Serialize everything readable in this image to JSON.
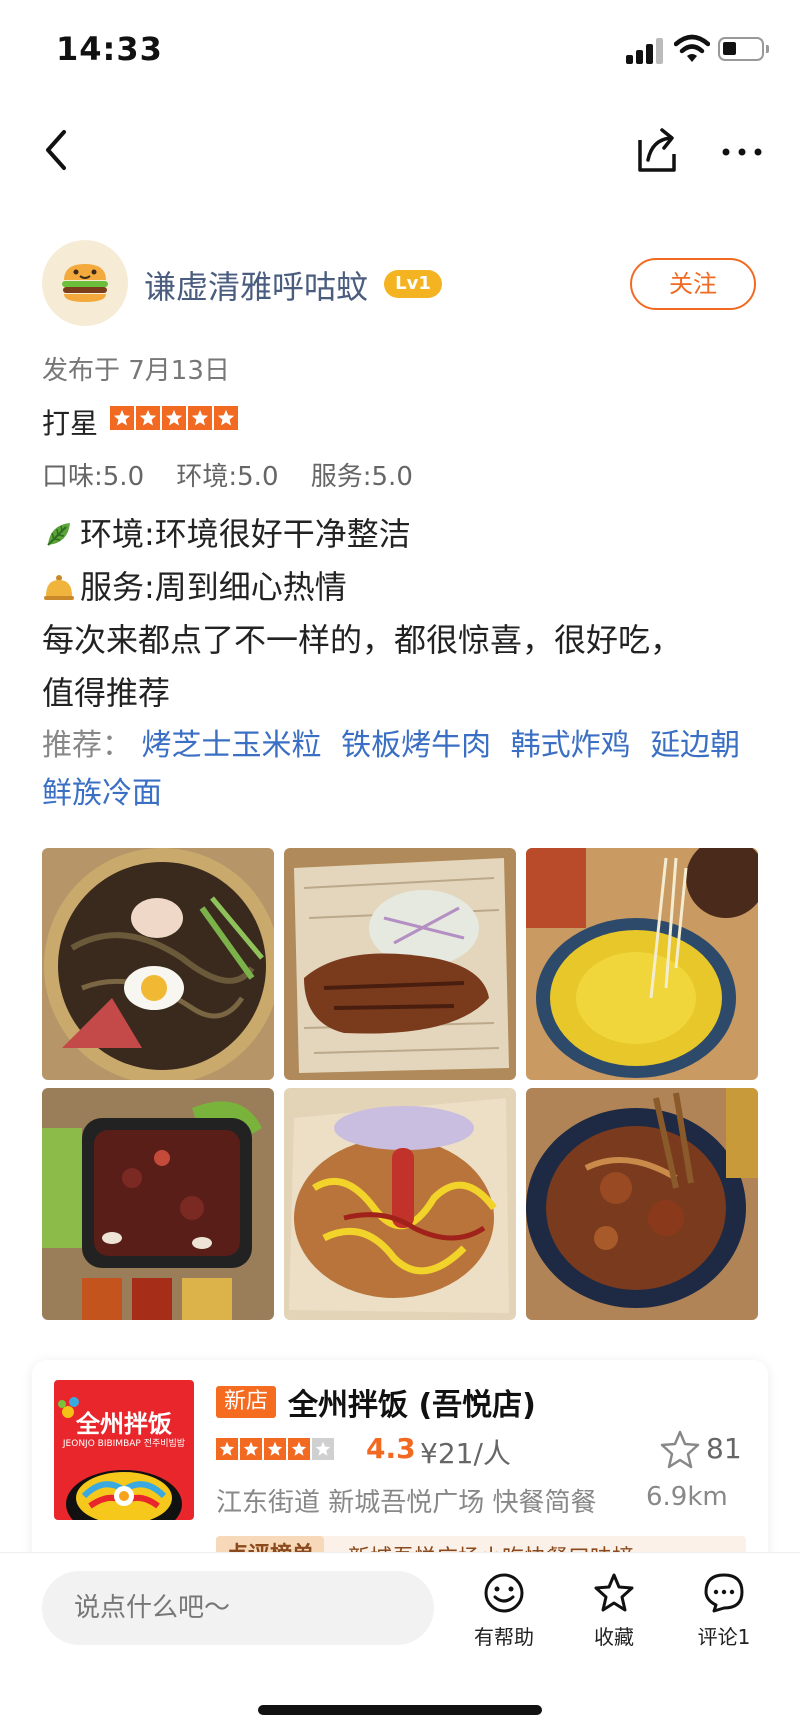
{
  "status_bar": {
    "time": "14:33"
  },
  "author": {
    "name": "谦虚清雅呼咕蚊",
    "level": "Lv1",
    "follow_label": "关注"
  },
  "post": {
    "date": "发布于 7月13日",
    "rating_label": "打星",
    "rating_stars": 5,
    "subscores": [
      "口味:5.0",
      "环境:5.0",
      "服务:5.0"
    ],
    "lines": [
      "环境:环境很好干净整洁",
      "服务:周到细心热情",
      "每次来都点了不一样的，都很惊喜，很好吃，",
      "值得推荐"
    ],
    "recommend_label": "推荐：",
    "recommend_dishes": [
      "烤芝士玉米粒",
      "铁板烤牛肉",
      "韩式炸鸡",
      "延边朝鲜族冷面"
    ]
  },
  "photos": [
    "冷面",
    "猪排",
    "芝士玉米",
    "烤牛肉",
    "炸鸡",
    "铁板鱿鱼"
  ],
  "shop": {
    "logo_text": "全州拌饭",
    "logo_subtext": "JEONJO BIBIMBAP 전주비빔밥",
    "new_badge": "新店",
    "name": "全州拌饭 (吾悦店)",
    "rating_stars": 4,
    "score": "4.3",
    "price": "¥21/人",
    "favorites": "81",
    "area": "江东街道 新城吾悦广场 快餐简餐",
    "distance": "6.9km",
    "rank_tag": "点评榜单",
    "rank_text": "新城吾悦广场小吃快餐口味榜"
  },
  "bottom_bar": {
    "input_placeholder": "说点什么吧～",
    "helpful_label": "有帮助",
    "collect_label": "收藏",
    "comment_label": "评论1"
  },
  "colors": {
    "accent": "#f26a22",
    "link": "#3a6fc4",
    "author": "#4a5d7e",
    "level_badge": "#f4b321"
  }
}
